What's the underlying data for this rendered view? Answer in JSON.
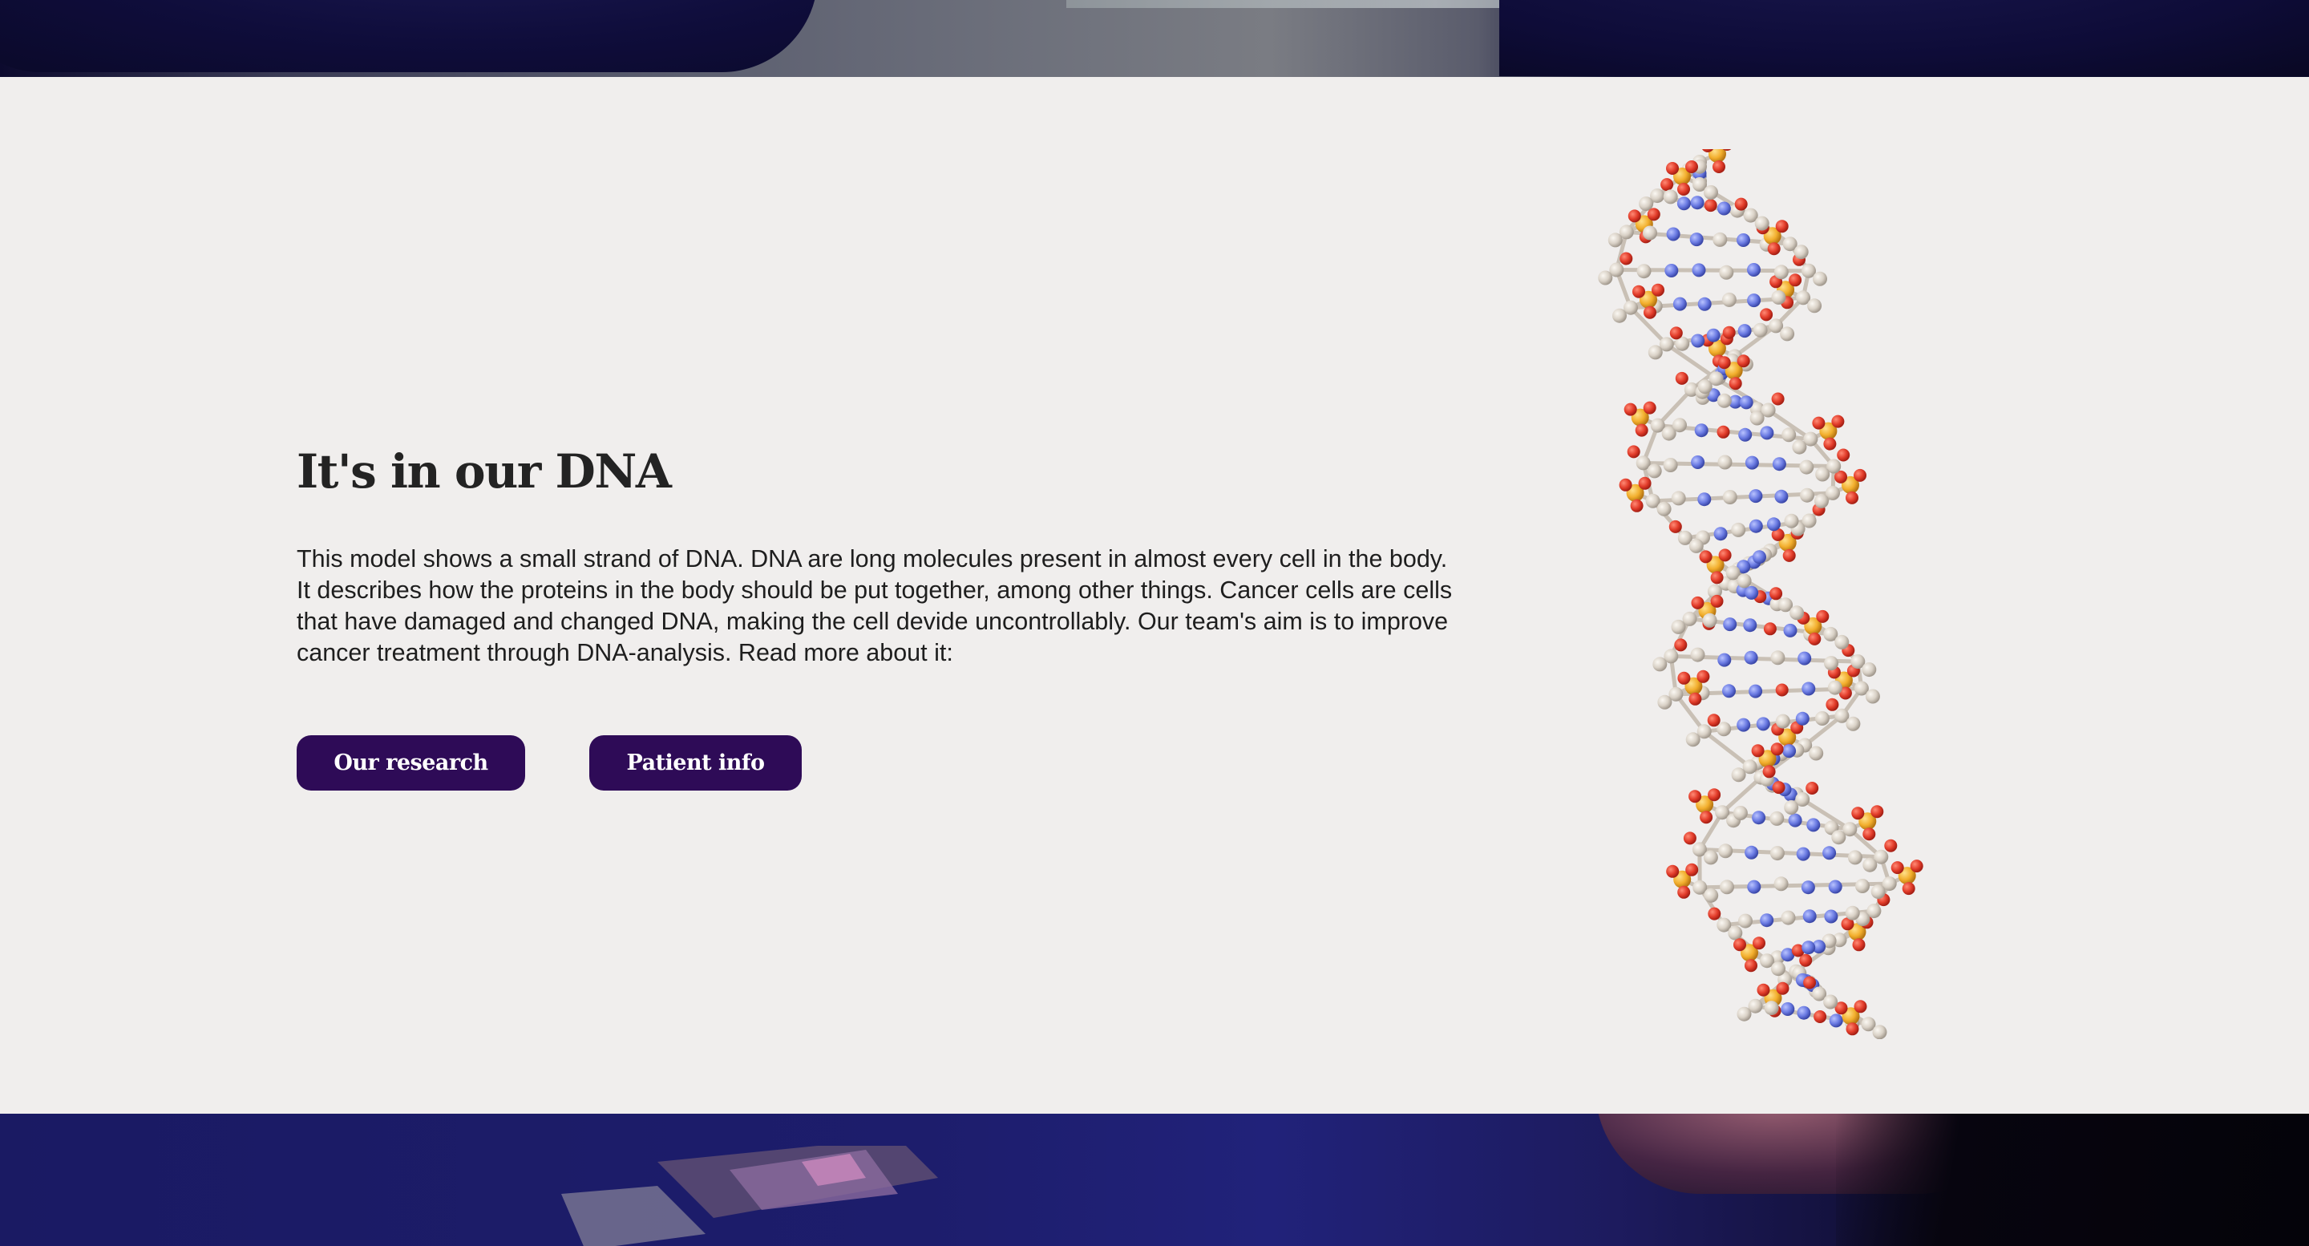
{
  "section": {
    "title": "It's in our DNA",
    "body": "This model shows a small strand of DNA. DNA are long molecules present in almost every cell in the body. It describes how the proteins in the body should be put together, among other things. Cancer cells are cells that have damaged and changed DNA, making the cell devide uncontrollably. Our team's aim is to improve cancer treatment through DNA-analysis. Read more about it:"
  },
  "buttons": {
    "research_label": "Our research",
    "patient_label": "Patient info"
  },
  "colors": {
    "background": "#f0eeed",
    "button_bg": "#2e0b57",
    "button_text": "#ffffff",
    "heading": "#232323",
    "atom_carbon": "#d7cfc4",
    "atom_oxygen": "#e0412f",
    "atom_nitrogen": "#6b7be0",
    "atom_phosphorus": "#f2b02f"
  }
}
